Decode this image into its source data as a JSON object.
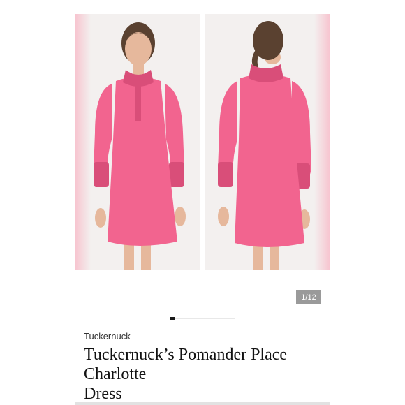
{
  "gallery": {
    "images": [
      {
        "name": "front-view",
        "view": "front"
      },
      {
        "name": "back-view",
        "view": "back"
      }
    ],
    "counter": "1/12",
    "colors": {
      "dress": "#f2648f",
      "dress_shade": "#d94e79",
      "backdrop": "#f3f0ef",
      "edge_glow": "#f7c5d0",
      "counter_bg": "#9a9a9a",
      "track": "#e8e8e8",
      "thumb": "#1a1a1a"
    }
  },
  "product": {
    "brand": "Tuckernuck",
    "title_lines": [
      "Tuckernuck’s Pomander Place",
      "Charlotte",
      "Dress"
    ]
  }
}
